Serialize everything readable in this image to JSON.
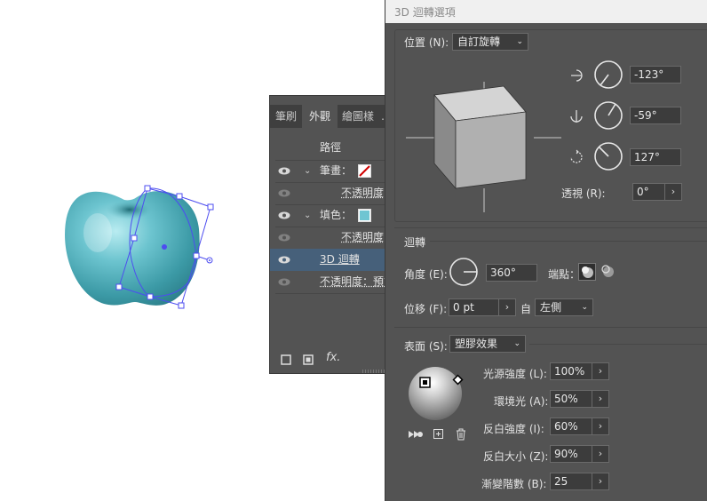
{
  "appearance": {
    "tabs": [
      "筆刷",
      "外觀",
      "繪圖樣",
      "…"
    ],
    "header": "路徑",
    "rows": [
      {
        "label": "筆畫：",
        "expander": "⌄"
      },
      {
        "label": "不透明度"
      },
      {
        "label": "填色：",
        "expander": "⌄"
      },
      {
        "label": "不透明度"
      },
      {
        "label": "3D 迴轉"
      },
      {
        "label": "不透明度：預設"
      }
    ],
    "footer_fx": "fx."
  },
  "dialog": {
    "title": "3D 迴轉選項",
    "position": {
      "label": "位置 (N):",
      "value": "自訂旋轉",
      "x_angle": "-123°",
      "y_angle": "-59°",
      "z_angle": "127°",
      "perspective_label": "透視 (R):",
      "perspective": "0°"
    },
    "revolve": {
      "section_title": "迴轉",
      "angle_label": "角度 (E):",
      "angle": "360°",
      "cap_label": "端點：",
      "offset_label": "位移 (F):",
      "offset": "0 pt",
      "from_label": "自",
      "from": "左側"
    },
    "surface": {
      "label": "表面 (S):",
      "value": "塑膠效果",
      "light_intensity_label": "光源強度 (L):",
      "light_intensity": "100%",
      "ambient_label": "環境光 (A):",
      "ambient": "50%",
      "highlight_intensity_label": "反白強度 (I):",
      "highlight_intensity": "60%",
      "highlight_size_label": "反白大小 (Z):",
      "highlight_size": "90%",
      "blend_steps_label": "漸變階數 (B):",
      "blend_steps": "25"
    },
    "step_glyph": "›",
    "caret_glyph": "⌄"
  },
  "colors": {
    "apple": "#4fb0bf",
    "selection": "#4d4df0",
    "panel": "#535353",
    "selected_row": "#46607a"
  }
}
